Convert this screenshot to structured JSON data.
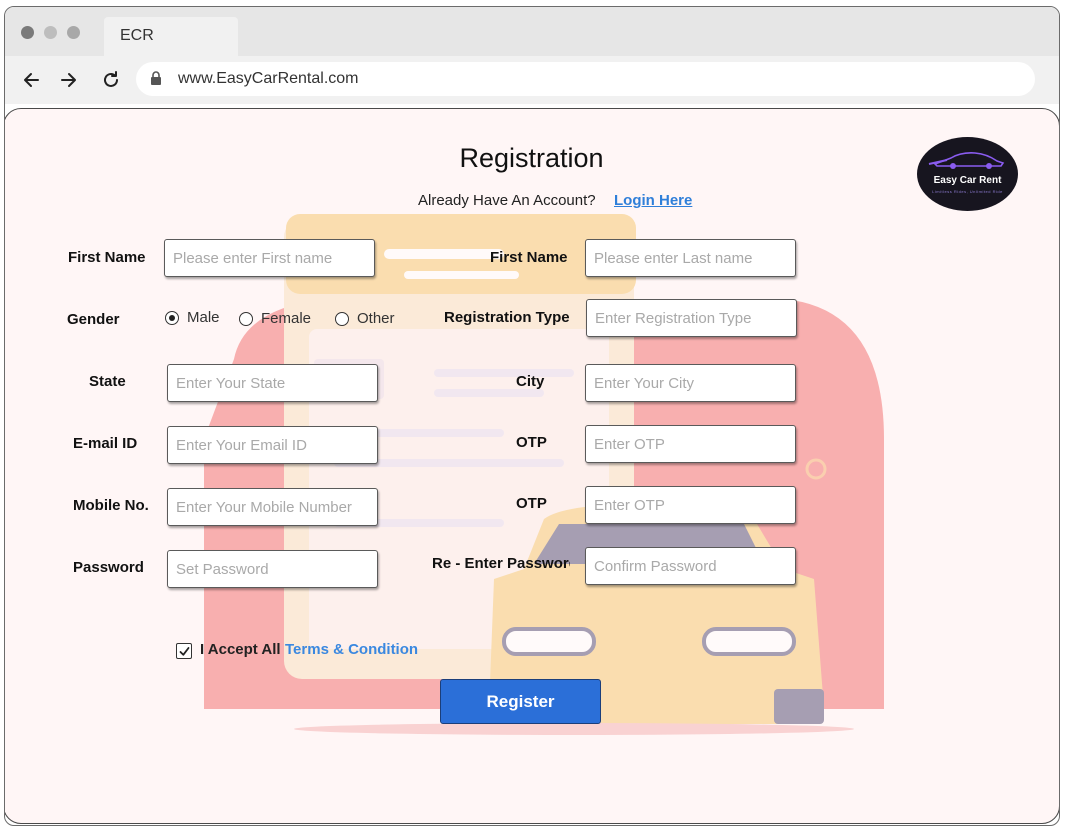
{
  "browser": {
    "tab_title": "ECR",
    "url": "www.EasyCarRental.com"
  },
  "header": {
    "title": "Registration",
    "have_account_text": "Already Have An Account?",
    "login_link": "Login Here",
    "logo_text": "Easy Car Rent",
    "logo_tagline": "Limitless Rides, Unlimited Ride"
  },
  "form": {
    "first_name": {
      "label": "First Name",
      "placeholder": "Please enter First name"
    },
    "last_name": {
      "label": "First Name",
      "placeholder": "Please enter Last name"
    },
    "gender": {
      "label": "Gender",
      "options": [
        "Male",
        "Female",
        "Other"
      ],
      "selected": "Male"
    },
    "registration_type": {
      "label": "Registration Type",
      "placeholder": "Enter Registration Type"
    },
    "state": {
      "label": "State",
      "placeholder": "Enter Your State"
    },
    "city": {
      "label": "City",
      "placeholder": "Enter Your City"
    },
    "email": {
      "label": "E-mail ID",
      "placeholder": "Enter Your Email ID"
    },
    "email_otp": {
      "label": "OTP",
      "placeholder": "Enter OTP"
    },
    "mobile": {
      "label": "Mobile No.",
      "placeholder": "Enter Your Mobile Number"
    },
    "mobile_otp": {
      "label": "OTP",
      "placeholder": "Enter OTP"
    },
    "password": {
      "label": "Password",
      "placeholder": "Set Password"
    },
    "confirm_password": {
      "label": "Re - Enter Password",
      "placeholder": "Confirm Password"
    },
    "accept_text": "I Accept All",
    "terms_link": "Terms & Condition",
    "accept_checked": true,
    "register_label": "Register"
  },
  "colors": {
    "accent": "#2b6fd8",
    "link": "#2f7fd9",
    "page_bg": "#fff6f6"
  }
}
